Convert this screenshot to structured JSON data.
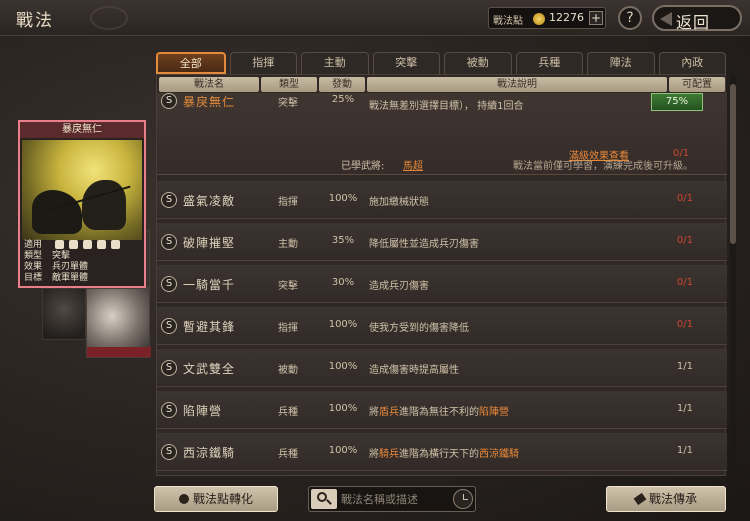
{
  "header": {
    "title": "戰法",
    "points_label": "戰法點",
    "points_value": "12276",
    "plus": "+",
    "help": "?",
    "back": "返回"
  },
  "tabs": [
    "全部",
    "指揮",
    "主動",
    "突擊",
    "被動",
    "兵種",
    "陣法",
    "內政"
  ],
  "active_tab": 0,
  "columns": {
    "name": "戰法名",
    "type": "類型",
    "rate": "發動",
    "desc": "戰法說明",
    "count": "可配置"
  },
  "expanded": {
    "badge": "S",
    "name": "暴戾無仁",
    "type": "突擊",
    "rate": "25%",
    "desc": "戰法無差別選擇目標）， 持續1回合",
    "equip_label": "75%",
    "max_effect_link": "滿級效果查看",
    "count": "0/1",
    "learned_label": "已學武將:",
    "learned_value": "馬超",
    "learned_note": "戰法當前僅可學習，演練完成後可升級。"
  },
  "rows": [
    {
      "badge": "S",
      "name": "盛氣凌敵",
      "type": "指揮",
      "rate": "100%",
      "desc": "施加繳械狀態",
      "count": "0/1",
      "red": true
    },
    {
      "badge": "S",
      "name": "破陣摧堅",
      "type": "主動",
      "rate": "35%",
      "desc": "降低屬性並造成兵刃傷害",
      "count": "0/1",
      "red": true
    },
    {
      "badge": "S",
      "name": "一騎當千",
      "type": "突擊",
      "rate": "30%",
      "desc": "造成兵刃傷害",
      "count": "0/1",
      "red": true
    },
    {
      "badge": "S",
      "name": "暫避其鋒",
      "type": "指揮",
      "rate": "100%",
      "desc": "使我方受到的傷害降低",
      "count": "0/1",
      "red": true
    },
    {
      "badge": "S",
      "name": "文武雙全",
      "type": "被動",
      "rate": "100%",
      "desc": "造成傷害時提高屬性",
      "count": "1/1",
      "red": false
    },
    {
      "badge": "S",
      "name": "陷陣營",
      "type": "兵種",
      "rate": "100%",
      "desc_pre": "將",
      "desc_hl1": "盾兵",
      "desc_mid": "進階為無往不利的",
      "desc_hl2": "陷陣營",
      "count": "1/1",
      "red": false
    },
    {
      "badge": "S",
      "name": "西涼鐵騎",
      "type": "兵種",
      "rate": "100%",
      "desc_pre": "將",
      "desc_hl1": "騎兵",
      "desc_mid": "進階為橫行天下的",
      "desc_hl2": "西涼鐵騎",
      "count": "1/1",
      "red": false
    }
  ],
  "card": {
    "title": "暴戾無仁",
    "k_apply": "適用",
    "k_type": "類型",
    "v_type": "突擊",
    "k_effect": "效果",
    "v_effect": "兵刃單體",
    "k_target": "目標",
    "v_target": "敵軍單體"
  },
  "bottom": {
    "convert": "戰法點轉化",
    "search_placeholder": "戰法名稱或描述",
    "inherit": "戰法傳承"
  }
}
